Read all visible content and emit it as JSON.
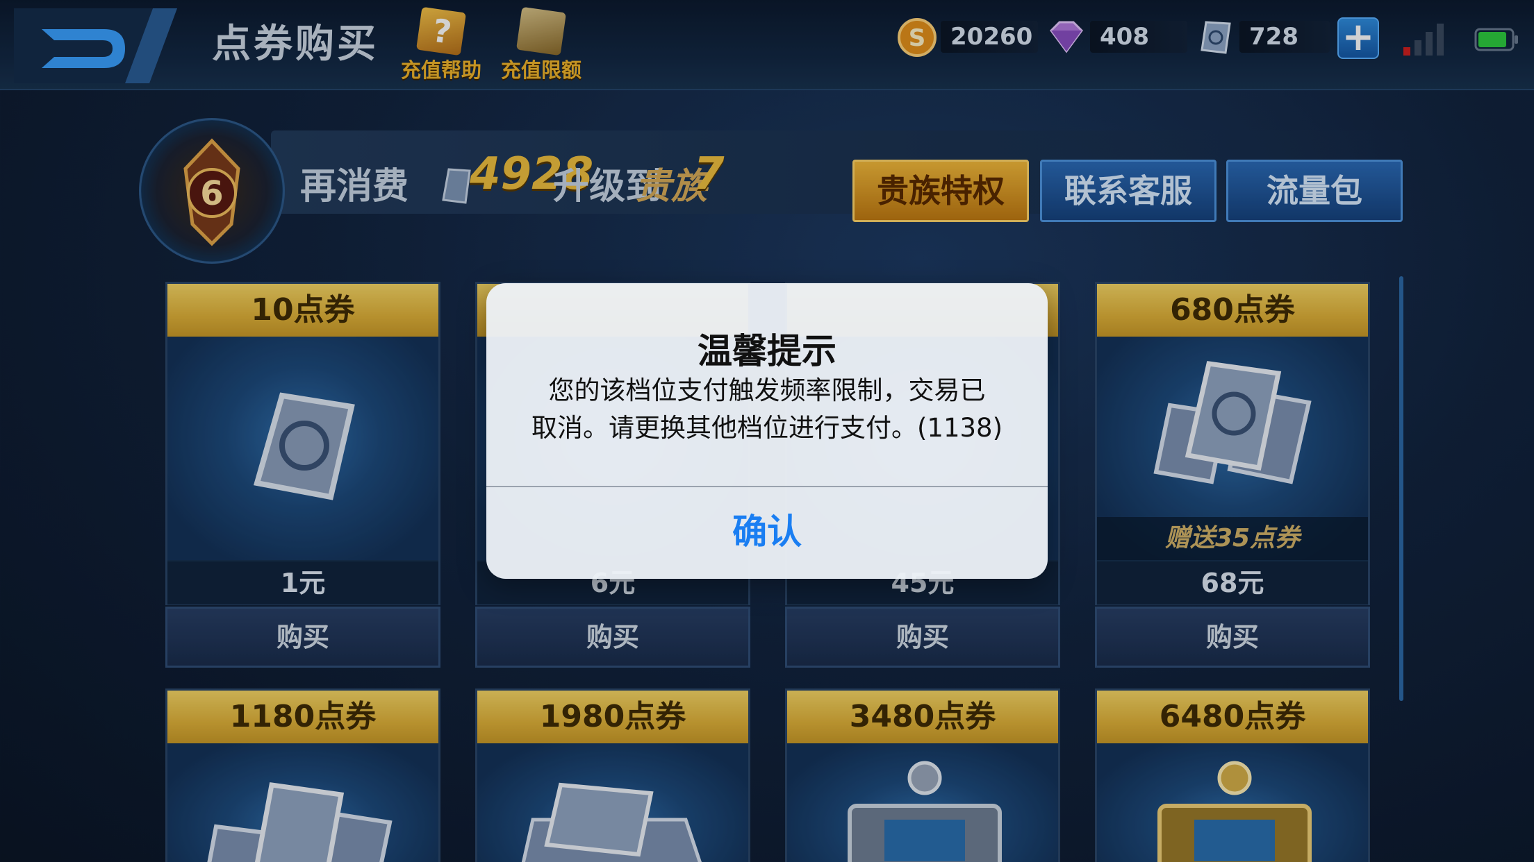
{
  "header": {
    "title": "点券购买",
    "helpers": [
      {
        "label": "充值帮助",
        "icon": "help-book-icon"
      },
      {
        "label": "充值限额",
        "icon": "limit-book-icon"
      }
    ],
    "currencies": [
      {
        "name": "gold",
        "icon": "gold-coin-icon",
        "value": "20260"
      },
      {
        "name": "diamond",
        "icon": "diamond-icon",
        "value": "408"
      },
      {
        "name": "voucher",
        "icon": "voucher-ticket-icon",
        "value": "728"
      }
    ],
    "plus_label": "+"
  },
  "vip": {
    "level": "6",
    "prefix": "再消费",
    "amount": "4928",
    "middle": "升级到",
    "target_label": "贵族",
    "target_level": "7",
    "buttons": [
      "贵族特权",
      "联系客服",
      "流量包"
    ]
  },
  "products_row1": [
    {
      "title": "10点券",
      "price": "1元",
      "buy": "购买",
      "bonus": ""
    },
    {
      "title": "",
      "price": "6元",
      "buy": "购买",
      "bonus": ""
    },
    {
      "title": "",
      "price": "45元",
      "buy": "购买",
      "bonus": ""
    },
    {
      "title": "680点券",
      "price": "68元",
      "buy": "购买",
      "bonus": "赠送35点券"
    }
  ],
  "products_row2": [
    {
      "title": "1180点券"
    },
    {
      "title": "1980点券"
    },
    {
      "title": "3480点券"
    },
    {
      "title": "6480点券"
    }
  ],
  "alert": {
    "title": "温馨提示",
    "message_line1": "您的该档位支付触发频率限制，交易已",
    "message_line2": "取消。请更换其他档位进行支付。(1138)",
    "confirm": "确认"
  },
  "colors": {
    "accent_gold": "#f0b52c",
    "ios_blue": "#1a7ef2",
    "card_header": "#e0b23a"
  }
}
